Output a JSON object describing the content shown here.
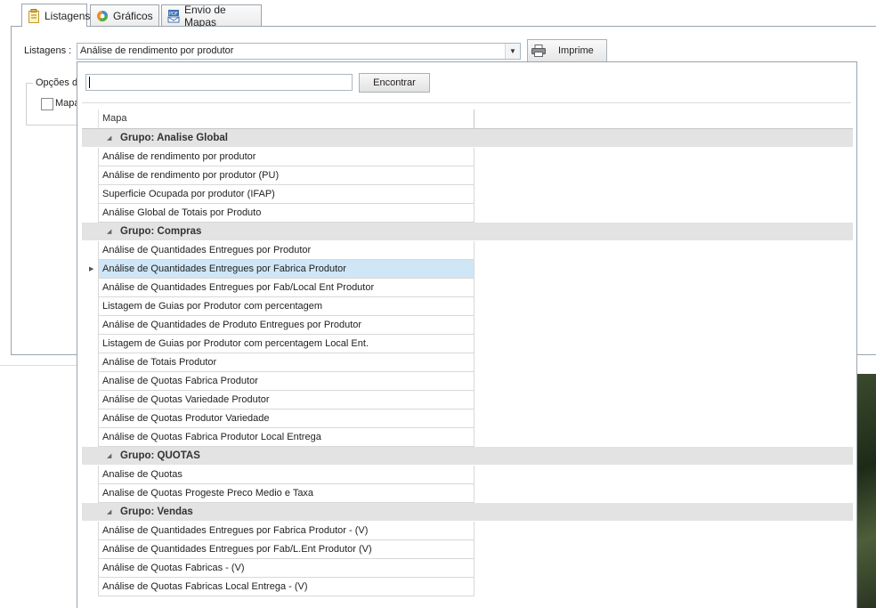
{
  "tabs": [
    {
      "label": "Listagens",
      "icon": "clipboard-icon"
    },
    {
      "label": "Gráficos",
      "icon": "pie-chart-icon"
    },
    {
      "label": "Envio de Mapas",
      "icon": "pdf-mail-icon"
    }
  ],
  "form": {
    "listagens_label": "Listagens :",
    "combo_value": "Análise de rendimento por produtor",
    "print_label": "Imprime",
    "options_title": "Opções de",
    "checkbox_label": "Mapa"
  },
  "popup": {
    "search_value": "",
    "find_label": "Encontrar",
    "column_header": "Mapa",
    "groups": [
      {
        "title": "Grupo: Analise Global",
        "items": [
          "Análise de rendimento por produtor",
          "Análise de rendimento por produtor (PU)",
          "Superficie Ocupada por produtor (IFAP)",
          "Análise Global de Totais por Produto"
        ]
      },
      {
        "title": "Grupo: Compras",
        "items": [
          "Análise de Quantidades Entregues por Produtor",
          "Análise de Quantidades Entregues por Fabrica Produtor",
          "Análise de Quantidades Entregues por Fab/Local Ent Produtor",
          "Listagem de Guias por Produtor com percentagem",
          "Análise de Quantidades de Produto Entregues por Produtor",
          "Listagem de Guias por Produtor com percentagem Local Ent.",
          "Análise de Totais Produtor",
          "Analise de Quotas Fabrica Produtor",
          "Análise de Quotas Variedade Produtor",
          "Análise de Quotas Produtor Variedade",
          "Análise de Quotas Fabrica Produtor Local Entrega"
        ]
      },
      {
        "title": "Grupo: QUOTAS",
        "items": [
          "Analise de Quotas",
          "Analise de Quotas Progeste Preco Medio e Taxa"
        ]
      },
      {
        "title": "Grupo: Vendas",
        "items": [
          "Análise de Quantidades Entregues por Fabrica Produtor - (V)",
          "Análise de Quantidades Entregues por Fab/L.Ent Produtor (V)",
          "Análise de Quotas Fabricas - (V)",
          "Análise de Quotas Fabricas Local Entrega - (V)"
        ]
      }
    ],
    "selected_item": "Análise de Quantidades Entregues por Fabrica Produtor"
  }
}
